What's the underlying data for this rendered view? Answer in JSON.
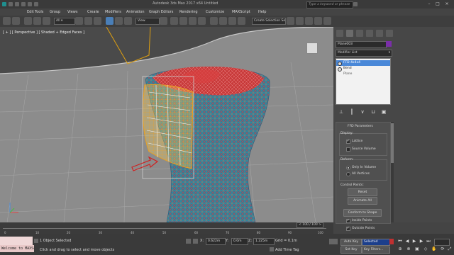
{
  "window": {
    "title": "Autodesk 3ds Max 2017 x64     Untitled",
    "search_placeholder": "Type a keyword or phrase",
    "minimize": "–",
    "maximize": "□",
    "close": "×"
  },
  "menu": [
    "Edit",
    "Tools",
    "Group",
    "Views",
    "Create",
    "Modifiers",
    "Animation",
    "Graph Editors",
    "Rendering",
    "Customize",
    "MAXScript",
    "Help"
  ],
  "toolbar": {
    "view_dropdown": "View",
    "selection_set": "Create Selection Se"
  },
  "viewport": {
    "label": "[ + ] [ Perspective ] [ Shaded + Edged Faces ]"
  },
  "command_panel": {
    "object_name": "Plane003",
    "object_color": "#7a2ea8",
    "modifier_list": "Modifier List",
    "stack": [
      {
        "label": "FFD 4x4x4",
        "selected": true
      },
      {
        "label": "Bend",
        "selected": false
      },
      {
        "label": "Plane",
        "selected": false
      }
    ],
    "ffd": {
      "title": "FFD Parameters",
      "display_label": "Display:",
      "lattice": "Lattice",
      "source_volume": "Source Volume",
      "deform_label": "Deform:",
      "only_in_volume": "Only In Volume",
      "all_vertices": "All Vertices",
      "control_points_label": "Control Points:",
      "reset": "Reset",
      "animate_all": "Animate All",
      "conform_to_shape": "Conform to Shape",
      "inside_points": "Inside Points",
      "outside_points": "Outside Points"
    }
  },
  "timeline": {
    "slider": "< 100 / 100 >",
    "ticks": [
      "0",
      "10",
      "20",
      "30",
      "40",
      "50",
      "60",
      "70",
      "80",
      "90",
      "100"
    ]
  },
  "status": {
    "maxscript": "Welcome to MAXScript.",
    "selection": "1 Object Selected",
    "prompt": "Click and drag to select and move objects",
    "x_label": "X:",
    "x_value": "0.622m",
    "y_label": "Y:",
    "y_value": "0.0m",
    "z_label": "Z:",
    "z_value": "1.225m",
    "grid": "Grid = 0.1m",
    "add_time_tag": "Add Time Tag",
    "auto_key": "Auto Key",
    "set_key": "Set Key",
    "selected": "Selected",
    "key_filters": "Key Filters..."
  }
}
